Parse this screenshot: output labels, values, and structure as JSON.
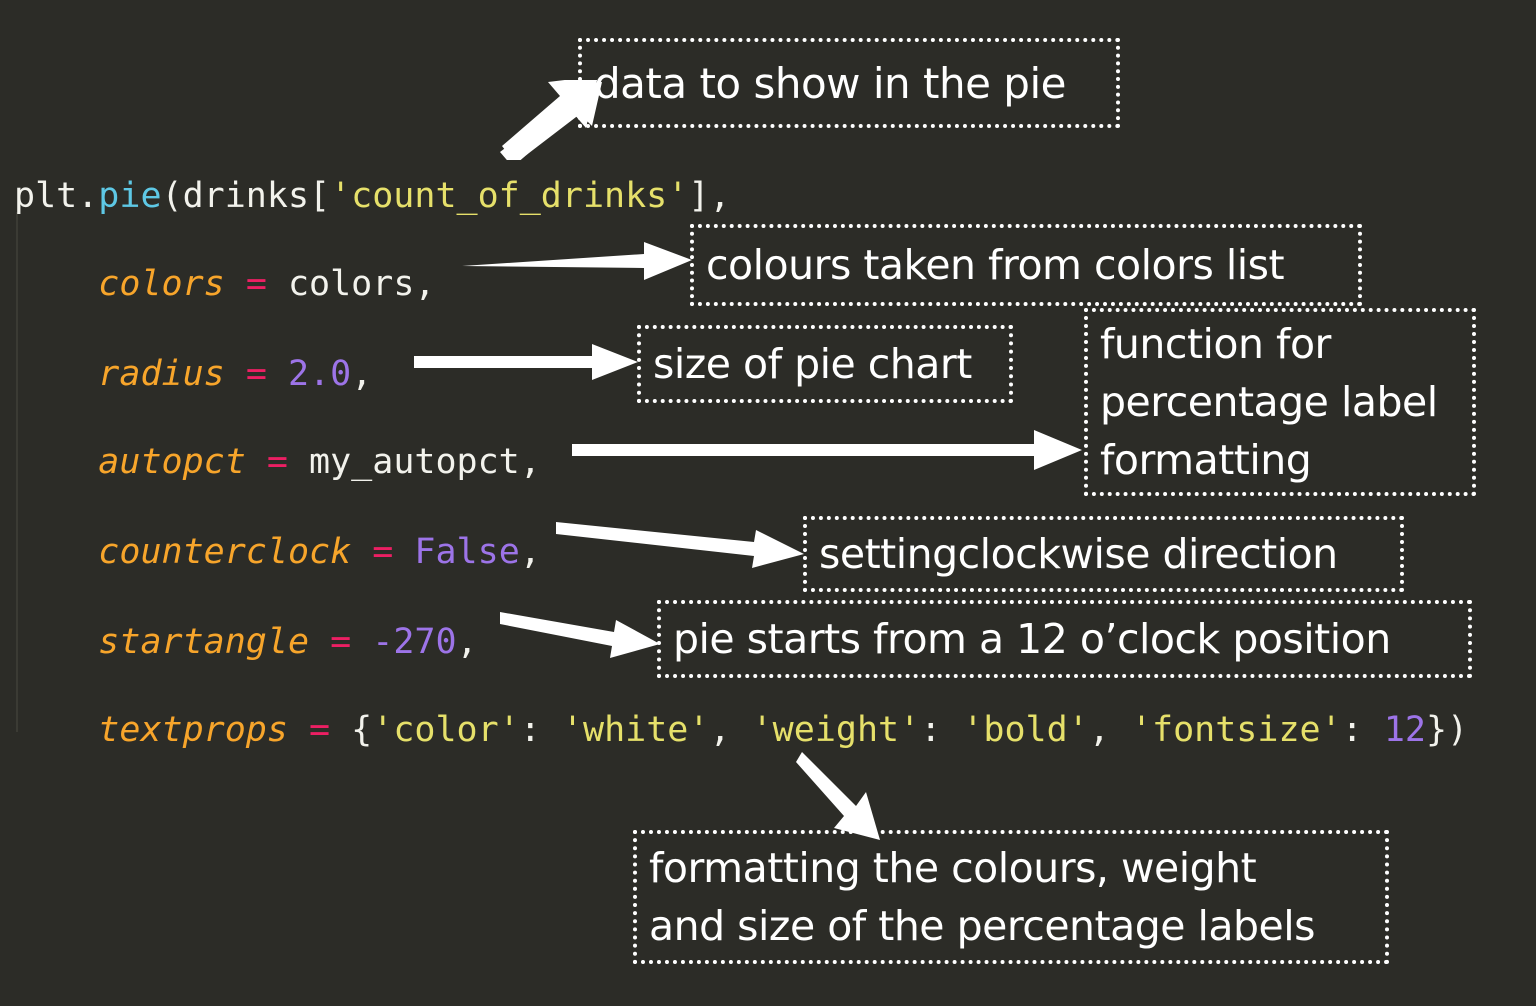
{
  "theme": {
    "background": "#2c2c27",
    "text_white": "#f2f2ec",
    "function_cyan": "#5ec8e5",
    "string_yellow": "#e6e06a",
    "param_orange": "#f7a52b",
    "equals_pink": "#ec1f63",
    "number_purple": "#9d74e8",
    "annotation_white": "#ffffff"
  },
  "code": {
    "language": "python",
    "full_text": "plt.pie(drinks['count_of_drinks'],\n    colors = colors,\n    radius = 2.0,\n    autopct = my_autopct,\n    counterclock = False,\n    startangle = -270,\n    textprops = {'color': 'white', 'weight': 'bold', 'fontsize': 12})",
    "lines": [
      {
        "id": "line-call",
        "tokens": [
          {
            "t": "plt.",
            "c": "plain"
          },
          {
            "t": "pie",
            "c": "fn"
          },
          {
            "t": "(drinks[",
            "c": "plain"
          },
          {
            "t": "'count_of_drinks'",
            "c": "str"
          },
          {
            "t": "],",
            "c": "plain"
          }
        ]
      },
      {
        "id": "line-colors",
        "tokens": [
          {
            "t": "    ",
            "c": "plain"
          },
          {
            "t": "colors",
            "c": "param"
          },
          {
            "t": " ",
            "c": "plain"
          },
          {
            "t": "=",
            "c": "eq"
          },
          {
            "t": " colors,",
            "c": "plain"
          }
        ]
      },
      {
        "id": "line-radius",
        "tokens": [
          {
            "t": "    ",
            "c": "plain"
          },
          {
            "t": "radius",
            "c": "param"
          },
          {
            "t": " ",
            "c": "plain"
          },
          {
            "t": "=",
            "c": "eq"
          },
          {
            "t": " ",
            "c": "plain"
          },
          {
            "t": "2.0",
            "c": "num"
          },
          {
            "t": ",",
            "c": "plain"
          }
        ]
      },
      {
        "id": "line-autopct",
        "tokens": [
          {
            "t": "    ",
            "c": "plain"
          },
          {
            "t": "autopct",
            "c": "param"
          },
          {
            "t": " ",
            "c": "plain"
          },
          {
            "t": "=",
            "c": "eq"
          },
          {
            "t": " my_autopct,",
            "c": "plain"
          }
        ]
      },
      {
        "id": "line-counterclock",
        "tokens": [
          {
            "t": "    ",
            "c": "plain"
          },
          {
            "t": "counterclock",
            "c": "param"
          },
          {
            "t": " ",
            "c": "plain"
          },
          {
            "t": "=",
            "c": "eq"
          },
          {
            "t": " ",
            "c": "plain"
          },
          {
            "t": "False",
            "c": "num"
          },
          {
            "t": ",",
            "c": "plain"
          }
        ]
      },
      {
        "id": "line-startangle",
        "tokens": [
          {
            "t": "    ",
            "c": "plain"
          },
          {
            "t": "startangle",
            "c": "param"
          },
          {
            "t": " ",
            "c": "plain"
          },
          {
            "t": "=",
            "c": "eq"
          },
          {
            "t": " ",
            "c": "plain"
          },
          {
            "t": "-270",
            "c": "num"
          },
          {
            "t": ",",
            "c": "plain"
          }
        ]
      },
      {
        "id": "line-textprops",
        "tokens": [
          {
            "t": "    ",
            "c": "plain"
          },
          {
            "t": "textprops",
            "c": "param"
          },
          {
            "t": " ",
            "c": "plain"
          },
          {
            "t": "=",
            "c": "eq"
          },
          {
            "t": " {",
            "c": "plain"
          },
          {
            "t": "'color'",
            "c": "str"
          },
          {
            "t": ": ",
            "c": "plain"
          },
          {
            "t": "'white'",
            "c": "str"
          },
          {
            "t": ", ",
            "c": "plain"
          },
          {
            "t": "'weight'",
            "c": "str"
          },
          {
            "t": ": ",
            "c": "plain"
          },
          {
            "t": "'bold'",
            "c": "str"
          },
          {
            "t": ", ",
            "c": "plain"
          },
          {
            "t": "'fontsize'",
            "c": "str"
          },
          {
            "t": ": ",
            "c": "plain"
          },
          {
            "t": "12",
            "c": "num"
          },
          {
            "t": "})",
            "c": "plain"
          }
        ]
      }
    ]
  },
  "annotations": [
    {
      "id": "note-data",
      "lines": [
        "data to show in the pie"
      ],
      "target": "drinks['count_of_drinks']"
    },
    {
      "id": "note-colors",
      "lines": [
        "colours taken from colors list"
      ],
      "target": "colors = colors"
    },
    {
      "id": "note-radius",
      "lines": [
        "size of pie chart"
      ],
      "target": "radius = 2.0"
    },
    {
      "id": "note-autopct",
      "lines": [
        "function for",
        "percentage label",
        "formatting"
      ],
      "target": "autopct = my_autopct"
    },
    {
      "id": "note-counterclock",
      "lines": [
        "settingclockwise direction"
      ],
      "target": "counterclock = False"
    },
    {
      "id": "note-startangle",
      "lines": [
        "pie starts from a 12 o’clock position"
      ],
      "target": "startangle = -270"
    },
    {
      "id": "note-textprops",
      "lines": [
        "formatting the colours, weight",
        "and size of the percentage labels"
      ],
      "target": "textprops = {...}"
    }
  ],
  "arrows": [
    {
      "id": "arrow-data",
      "direction": "up-right"
    },
    {
      "id": "arrow-colors",
      "direction": "right"
    },
    {
      "id": "arrow-radius",
      "direction": "right"
    },
    {
      "id": "arrow-autopct",
      "direction": "right"
    },
    {
      "id": "arrow-counterclock",
      "direction": "right"
    },
    {
      "id": "arrow-startangle",
      "direction": "right"
    },
    {
      "id": "arrow-textprops",
      "direction": "down-right"
    }
  ]
}
